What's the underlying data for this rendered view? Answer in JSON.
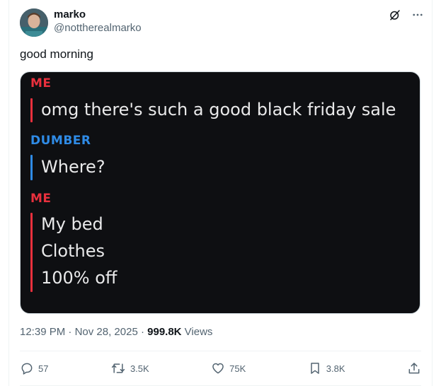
{
  "author": {
    "name": "marko",
    "handle": "@notthereal​marko"
  },
  "post": {
    "text": "good morning",
    "image": {
      "messages": [
        {
          "sender": "ME",
          "lines": [
            "omg there's such a good black friday sale"
          ],
          "color": "#e8303d"
        },
        {
          "sender": "DUMBER",
          "lines": [
            "Where?"
          ],
          "color": "#2f8be6"
        },
        {
          "sender": "ME",
          "lines": [
            "My bed",
            "Clothes",
            "100% off"
          ],
          "color": "#e8303d"
        }
      ]
    },
    "time": "12:39 PM",
    "separator1": " · ",
    "date": "Nov 28, 2025",
    "separator2": " · ",
    "views_count": "999.8K",
    "views_label": " Views"
  },
  "actions": {
    "replies": "57",
    "reposts": "3.5K",
    "likes": "75K",
    "bookmarks": "3.8K"
  },
  "icons": {
    "grok": "slashed-circle-icon",
    "more": "more-icon",
    "reply": "reply-icon",
    "repost": "repost-icon",
    "like": "heart-icon",
    "bookmark": "bookmark-icon",
    "share": "share-icon"
  }
}
